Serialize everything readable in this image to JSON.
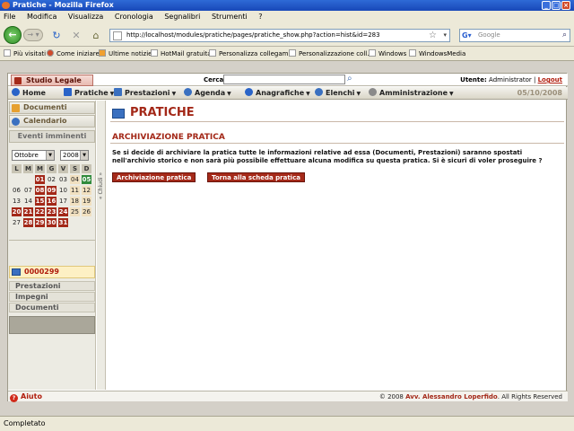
{
  "window": {
    "title": "Pratiche - Mozilla Firefox"
  },
  "menubar": [
    "File",
    "Modifica",
    "Visualizza",
    "Cronologia",
    "Segnalibri",
    "Strumenti",
    "?"
  ],
  "url": "http://localhost/modules/pratiche/pages/pratiche_show.php?action=hist&id=283",
  "search_placeholder": "Google",
  "bookmarks": [
    "Più visitati",
    "Come iniziare",
    "Ultime notizie",
    "HotMail gratuita",
    "Personalizza collegam...",
    "Personalizzazione coll...",
    "Windows",
    "WindowsMedia"
  ],
  "site": {
    "brand": "Studio Legale",
    "cerca_label": "Cerca:",
    "utente_label": "Utente:",
    "utente_name": "Administrator",
    "logout": "Logout",
    "date": "05/10/2008"
  },
  "mainmenu": [
    "Home",
    "Pratiche",
    "Prestazioni",
    "Agenda",
    "Anagrafiche",
    "Elenchi",
    "Amministrazione"
  ],
  "sidebar": {
    "documenti": "Documenti",
    "calendario": "Calendario",
    "eventi": "Eventi imminenti",
    "month": "Ottobre",
    "year": "2008",
    "weekdays": [
      "L",
      "M",
      "M",
      "G",
      "V",
      "S",
      "D"
    ],
    "weeks": [
      [
        "",
        "",
        "01",
        "02",
        "03",
        "04",
        "05"
      ],
      [
        "06",
        "07",
        "08",
        "09",
        "10",
        "11",
        "12"
      ],
      [
        "13",
        "14",
        "15",
        "16",
        "17",
        "18",
        "19"
      ],
      [
        "20",
        "21",
        "22",
        "23",
        "24",
        "25",
        "26"
      ],
      [
        "27",
        "28",
        "29",
        "30",
        "31",
        "",
        ""
      ]
    ],
    "pratica_id": "0000299",
    "links": [
      "Prestazioni",
      "Impegni",
      "Documenti"
    ],
    "chiudi": "« Chiudi »"
  },
  "content": {
    "title": "PRATICHE",
    "section": "ARCHIVIAZIONE PRATICA",
    "message": "Se si decide di archiviare la pratica tutte le informazioni relative ad essa (Documenti, Prestazioni) saranno spostati nell'archivio storico e non sarà più possibile effettuare alcuna modifica su questa pratica. Si è sicuri di voler proseguire ?",
    "btn_archive": "Archiviazione pratica",
    "btn_back": "Torna alla scheda pratica"
  },
  "footer": {
    "aiuto": "Aiuto",
    "copy_pre": "© 2008",
    "copy_author": "Avv. Alessandro Loperfido",
    "copy_post": ". All Rights Reserved"
  },
  "status": "Completato",
  "colors": {
    "accent": "#a32818",
    "today": "#2f8a3c",
    "titlebar": "#1848b8"
  }
}
